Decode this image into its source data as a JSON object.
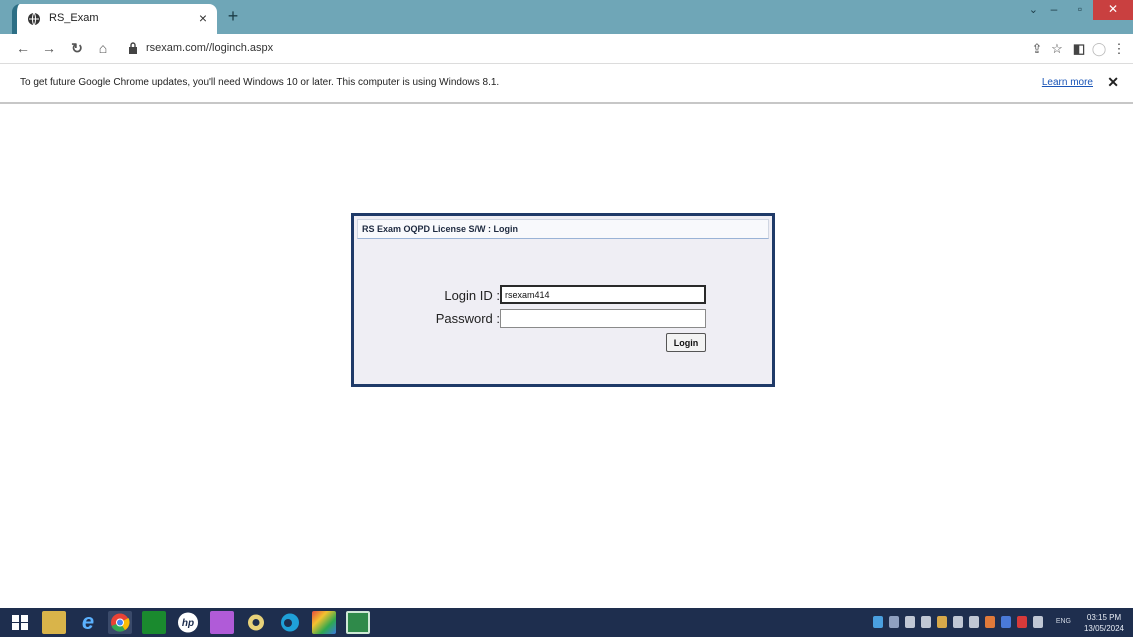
{
  "browser": {
    "tab_title": "RS_Exam",
    "tab_close": "×",
    "new_tab": "+",
    "url": "rsexam.com//loginch.aspx",
    "window_controls": {
      "minimize": "–",
      "maximize": "▫",
      "close": "✕"
    }
  },
  "infobar": {
    "message": "To get future Google Chrome updates, you'll need Windows 10 or later. This computer is using Windows 8.1.",
    "learn_more": "Learn more",
    "close": "✕"
  },
  "login": {
    "title": "RS Exam OQPD License S/W : Login",
    "login_id_label": "Login ID :",
    "login_id_value": "rsexam414",
    "password_label": "Password :",
    "password_value": "",
    "button_label": "Login"
  },
  "taskbar": {
    "language": "ENG",
    "time": "03:15 PM",
    "date": "13/05/2024",
    "apps": [
      "start-icon",
      "file-explorer-icon",
      "internet-explorer-icon",
      "chrome-icon",
      "store-icon",
      "hp-icon",
      "app-icon",
      "media-icon",
      "edge-icon",
      "photos-icon",
      "excel-icon"
    ]
  },
  "colors": {
    "title_bar": "#6fa6b7",
    "taskbar": "#1e2e4e",
    "login_border": "#1f3a68",
    "login_bg": "#efeef4"
  }
}
